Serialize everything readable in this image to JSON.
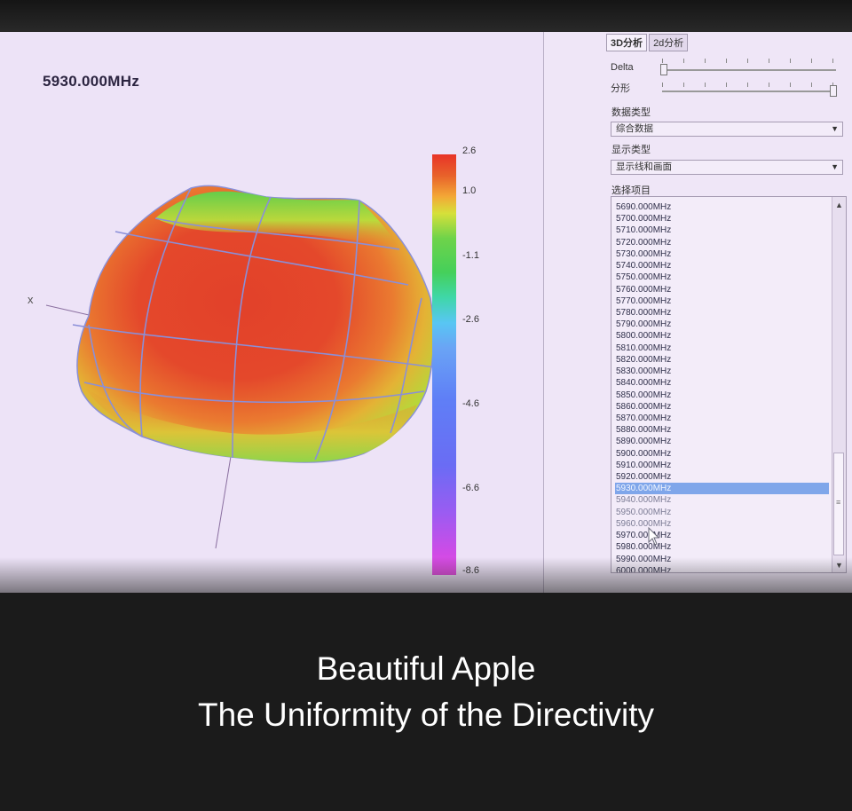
{
  "plot": {
    "frequency_title": "5930.000MHz",
    "axis_x_label": "x",
    "colorbar": {
      "ticks": [
        "2.6",
        "1.0",
        "-1.1",
        "-2.6",
        "-4.6",
        "-6.6",
        "-8.6"
      ],
      "max": 2.6,
      "min": -8.6
    }
  },
  "side_panel": {
    "tabs": [
      {
        "label": "3D分析",
        "active": true
      },
      {
        "label": "2d分析",
        "active": false
      }
    ],
    "sliders": [
      {
        "label": "Delta",
        "position": 0.0
      },
      {
        "label": "分形",
        "position": 1.0
      }
    ],
    "data_type_label": "数据类型",
    "data_type_value": "综合数据",
    "display_type_label": "显示类型",
    "display_type_value": "显示线和画面",
    "select_items_label": "选择项目",
    "items": [
      "5690.000MHz",
      "5700.000MHz",
      "5710.000MHz",
      "5720.000MHz",
      "5730.000MHz",
      "5740.000MHz",
      "5750.000MHz",
      "5760.000MHz",
      "5770.000MHz",
      "5780.000MHz",
      "5790.000MHz",
      "5800.000MHz",
      "5810.000MHz",
      "5820.000MHz",
      "5830.000MHz",
      "5840.000MHz",
      "5850.000MHz",
      "5860.000MHz",
      "5870.000MHz",
      "5880.000MHz",
      "5890.000MHz",
      "5900.000MHz",
      "5910.000MHz",
      "5920.000MHz",
      "5930.000MHz",
      "5940.000MHz",
      "5950.000MHz",
      "5960.000MHz",
      "5970.000MHz",
      "5980.000MHz",
      "5990.000MHz",
      "6000.000MHz"
    ],
    "selected_item": "5930.000MHz"
  },
  "caption": {
    "line1": "Beautiful Apple",
    "line2": "The Uniformity of the Directivity"
  },
  "colors": {
    "screen_background": "#e9ddf4",
    "selection": "#7fa6ea",
    "bezel": "#1b1b1b",
    "pattern_red": "#e1402a",
    "pattern_green": "#6dd04a"
  }
}
